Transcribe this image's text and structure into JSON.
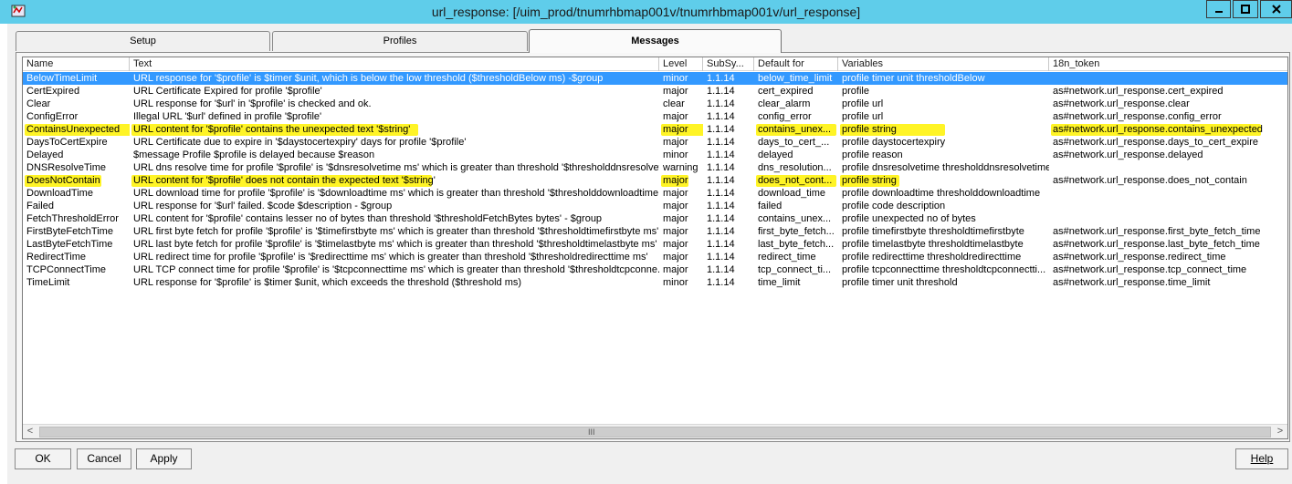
{
  "window": {
    "title": "url_response: [/uim_prod/tnumrhbmap001v/tnumrhbmap001v/url_response]",
    "controls": {
      "minimize": "—",
      "maximize": "□",
      "close": "✖"
    }
  },
  "tabs": [
    {
      "label": "Setup",
      "active": false
    },
    {
      "label": "Profiles",
      "active": false
    },
    {
      "label": "Messages",
      "active": true
    }
  ],
  "table": {
    "columns": [
      "Name",
      "Text",
      "Level",
      "SubSy...",
      "Default for",
      "Variables",
      "18n_token"
    ],
    "rows": [
      {
        "name": "BelowTimeLimit",
        "text": "URL response for '$profile' is $timer $unit, which is below the low threshold ($thresholdBelow ms) -$group",
        "level": "minor",
        "subsys": "1.1.14",
        "default_for": "below_time_limit",
        "variables": "profile timer unit thresholdBelow",
        "token": ""
      },
      {
        "name": "CertExpired",
        "text": "URL Certificate Expired for profile '$profile'",
        "level": "major",
        "subsys": "1.1.14",
        "default_for": "cert_expired",
        "variables": "profile",
        "token": "as#network.url_response.cert_expired"
      },
      {
        "name": "Clear",
        "text": "URL response for '$url' in '$profile' is checked and ok.",
        "level": "clear",
        "subsys": "1.1.14",
        "default_for": "clear_alarm",
        "variables": "profile url",
        "token": "as#network.url_response.clear"
      },
      {
        "name": "ConfigError",
        "text": "Illegal URL '$url' defined in profile '$profile'",
        "level": "major",
        "subsys": "1.1.14",
        "default_for": "config_error",
        "variables": "profile url",
        "token": "as#network.url_response.config_error"
      },
      {
        "name": "ContainsUnexpected",
        "text": "URL content for '$profile' contains the unexpected text '$string'",
        "level": "major",
        "subsys": "1.1.14",
        "default_for": "contains_unex...",
        "variables": "profile string",
        "token": "as#network.url_response.contains_unexpected"
      },
      {
        "name": "DaysToCertExpire",
        "text": "URL Certificate due to expire in '$daystocertexpiry' days for profile '$profile'",
        "level": "major",
        "subsys": "1.1.14",
        "default_for": "days_to_cert_...",
        "variables": "profile daystocertexpiry",
        "token": "as#network.url_response.days_to_cert_expire"
      },
      {
        "name": "Delayed",
        "text": "$message Profile $profile is delayed because $reason",
        "level": "minor",
        "subsys": "1.1.14",
        "default_for": "delayed",
        "variables": "profile reason",
        "token": "as#network.url_response.delayed"
      },
      {
        "name": "DNSResolveTime",
        "text": "URL dns resolve time for profile '$profile' is '$dnsresolvetime ms' which is greater than threshold '$thresholddnsresolveti...",
        "level": "warning",
        "subsys": "1.1.14",
        "default_for": "dns_resolution...",
        "variables": "profile dnsresolvetime thresholddnsresolvetime",
        "token": ""
      },
      {
        "name": "DoesNotContain",
        "text": "URL content for '$profile' does not contain the expected text '$string'",
        "level": "major",
        "subsys": "1.1.14",
        "default_for": "does_not_cont...",
        "variables": "profile string",
        "token": "as#network.url_response.does_not_contain"
      },
      {
        "name": "DownloadTime",
        "text": "URL download time for profile '$profile' is '$downloadtime ms' which is greater than threshold '$thresholddownloadtime ...",
        "level": "major",
        "subsys": "1.1.14",
        "default_for": "download_time",
        "variables": "profile downloadtime thresholddownloadtime",
        "token": ""
      },
      {
        "name": "Failed",
        "text": "URL response for '$url' failed. $code $description - $group",
        "level": "major",
        "subsys": "1.1.14",
        "default_for": "failed",
        "variables": "profile code description",
        "token": ""
      },
      {
        "name": "FetchThresholdError",
        "text": "URL content for '$profile' contains lesser no of bytes than threshold '$thresholdFetchBytes bytes' - $group",
        "level": "major",
        "subsys": "1.1.14",
        "default_for": "contains_unex...",
        "variables": "profile unexpected no of bytes",
        "token": ""
      },
      {
        "name": "FirstByteFetchTime",
        "text": "URL first byte fetch for profile '$profile' is '$timefirstbyte ms' which is greater than threshold '$thresholdtimefirstbyte ms'",
        "level": "major",
        "subsys": "1.1.14",
        "default_for": "first_byte_fetch...",
        "variables": "profile timefirstbyte thresholdtimefirstbyte",
        "token": "as#network.url_response.first_byte_fetch_time"
      },
      {
        "name": "LastByteFetchTime",
        "text": "URL last byte fetch for profile '$profile' is '$timelastbyte ms' which is greater than threshold '$thresholdtimelastbyte ms'",
        "level": "major",
        "subsys": "1.1.14",
        "default_for": "last_byte_fetch...",
        "variables": "profile timelastbyte thresholdtimelastbyte",
        "token": "as#network.url_response.last_byte_fetch_time"
      },
      {
        "name": "RedirectTime",
        "text": "URL redirect time for profile '$profile' is '$redirecttime ms' which is greater than threshold '$thresholdredirecttime ms'",
        "level": "major",
        "subsys": "1.1.14",
        "default_for": "redirect_time",
        "variables": "profile redirecttime thresholdredirecttime",
        "token": "as#network.url_response.redirect_time"
      },
      {
        "name": "TCPConnectTime",
        "text": "URL TCP connect time for profile '$profile' is '$tcpconnecttime ms' which is greater than threshold '$thresholdtcpconne...",
        "level": "major",
        "subsys": "1.1.14",
        "default_for": "tcp_connect_ti...",
        "variables": "profile tcpconnecttime thresholdtcpconnectti...",
        "token": "as#network.url_response.tcp_connect_time"
      },
      {
        "name": "TimeLimit",
        "text": "URL response for '$profile' is $timer $unit, which exceeds the threshold ($threshold ms)",
        "level": "minor",
        "subsys": "1.1.14",
        "default_for": "time_limit",
        "variables": "profile timer unit threshold",
        "token": "as#network.url_response.time_limit"
      }
    ],
    "selected_row": "BelowTimeLimit",
    "highlighted_rows": [
      "ContainsUnexpected",
      "DoesNotContain"
    ],
    "scrollbar": {
      "left_arrow": "<",
      "right_arrow": ">",
      "grip": "III"
    }
  },
  "buttons": {
    "ok": "OK",
    "cancel": "Cancel",
    "apply": "Apply",
    "help": "Help"
  },
  "colors": {
    "titlebar": "#5fcdea",
    "selection": "#3399ff",
    "highlight": "#fff200"
  }
}
